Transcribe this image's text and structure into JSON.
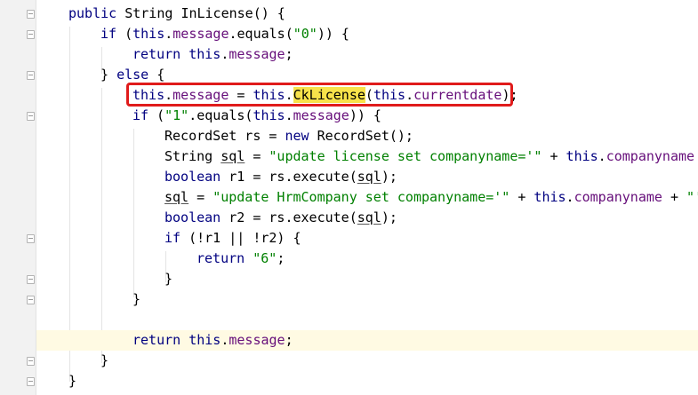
{
  "code": {
    "l1": {
      "kw1": "public ",
      "t1": "String ",
      "name": "InLicense",
      "t2": "() {"
    },
    "l2": {
      "kw": "if ",
      "t1": "(",
      "kw2": "this",
      "t2": ".",
      "f1": "message",
      "t3": ".equals(",
      "s1": "\"0\"",
      "t4": ")) {"
    },
    "l3": {
      "kw": "return ",
      "kw2": "this",
      "t1": ".",
      "f1": "message",
      "t2": ";"
    },
    "l4": {
      "t1": "} ",
      "kw": "else ",
      "t2": "{"
    },
    "l5": {
      "kw1": "this",
      "t1": ".",
      "f1": "message",
      "t2": " = ",
      "kw2": "this",
      "t3": ".",
      "m": "CkLicense",
      "t4": "(",
      "kw3": "this",
      "t5": ".",
      "f2": "currentdate",
      "t6": ");"
    },
    "l6": {
      "kw": "if ",
      "t1": "(",
      "s1": "\"1\"",
      "t2": ".equals(",
      "kw2": "this",
      "t3": ".",
      "f1": "message",
      "t4": ")) {"
    },
    "l7": {
      "t1": "RecordSet rs = ",
      "kw": "new ",
      "t2": "RecordSet();"
    },
    "l8": {
      "t1": "String ",
      "v": "sql",
      "t2": " = ",
      "s1": "\"update license set companyname='\"",
      "t3": " + ",
      "kw": "this",
      "t4": ".",
      "f1": "companyname"
    },
    "l9": {
      "kw": "boolean ",
      "t1": "r1 = rs.execute(",
      "v": "sql",
      "t2": ");"
    },
    "l10": {
      "v": "sql",
      "t1": " = ",
      "s1": "\"update HrmCompany set companyname='\"",
      "t2": " + ",
      "kw": "this",
      "t3": ".",
      "f1": "companyname",
      "t4": " + ",
      "s2": "\"'"
    },
    "l11": {
      "kw": "boolean ",
      "t1": "r2 = rs.execute(",
      "v": "sql",
      "t2": ");"
    },
    "l12": {
      "kw": "if ",
      "t1": "(!r1 || !r2) {"
    },
    "l13": {
      "kw": "return ",
      "s1": "\"6\"",
      "t1": ";"
    },
    "l14": {
      "t1": "}"
    },
    "l15": {
      "t1": "}"
    },
    "l17": {
      "kw": "return ",
      "kw2": "this",
      "t1": ".",
      "f1": "message",
      "t2": ";"
    },
    "l18": {
      "t1": "}"
    },
    "l19": {
      "t1": "}"
    }
  },
  "colors": {
    "keyword": "#000080",
    "field": "#660e7a",
    "string": "#008000",
    "highlight": "#f7e24a",
    "current_line": "#fffae3",
    "callout_border": "#e01b1b"
  },
  "icons": [
    "fold-marker-icon"
  ]
}
